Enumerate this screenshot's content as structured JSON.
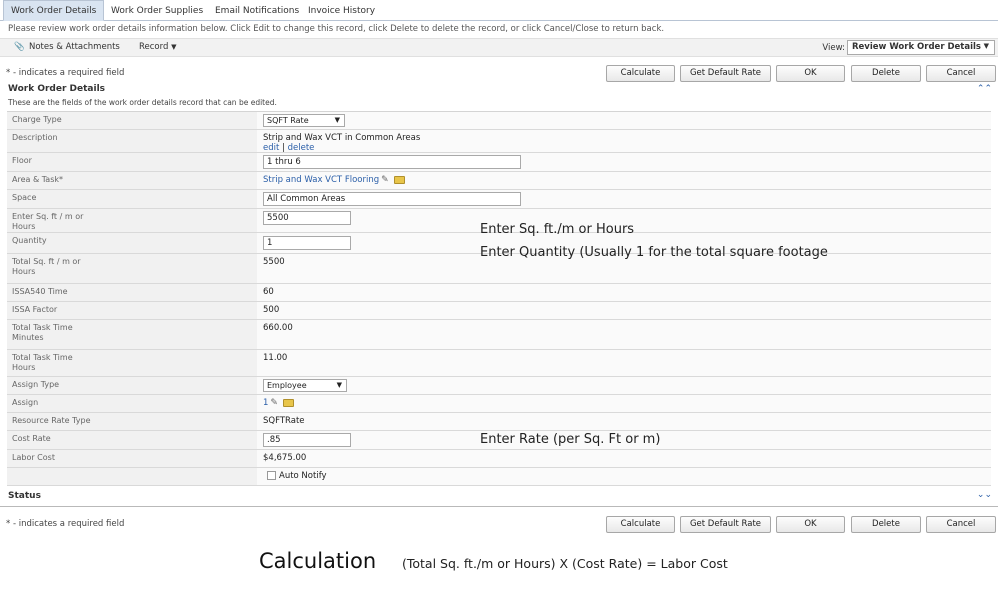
{
  "tabs": [
    {
      "label": "Work Order Details"
    },
    {
      "label": "Work Order Supplies"
    },
    {
      "label": "Email Notifications"
    },
    {
      "label": "Invoice History"
    }
  ],
  "instructions": "Please review work order details information below. Click Edit to change this record, click Delete to delete the record, or click Cancel/Close to return back.",
  "toolbar": {
    "notes_label": "Notes & Attachments",
    "record_label": "Record",
    "view_label": "View:",
    "view_value": "Review Work Order Details"
  },
  "required_note": "* - indicates a required field",
  "buttons": {
    "calculate": "Calculate",
    "get_default_rate": "Get Default Rate",
    "ok": "OK",
    "delete": "Delete",
    "cancel": "Cancel"
  },
  "section": {
    "title": "Work Order Details",
    "subtitle": "These are the fields of the work order details record that can be edited.",
    "status_title": "Status"
  },
  "fields": {
    "charge_type": {
      "label": "Charge Type",
      "value": "SQFT Rate"
    },
    "description": {
      "label": "Description",
      "value": "Strip and Wax VCT in Common Areas",
      "edit": "edit",
      "sep": "|",
      "delete": "delete"
    },
    "floor": {
      "label": "Floor",
      "value": "1 thru 6"
    },
    "area_task": {
      "label": "Area & Task*",
      "value": "Strip and Wax VCT Flooring"
    },
    "space": {
      "label": "Space",
      "value": "All Common Areas"
    },
    "enter_sqft": {
      "label_1": "Enter Sq. ft / m or",
      "label_2": "Hours",
      "value": "5500"
    },
    "quantity": {
      "label": "Quantity",
      "value": "1"
    },
    "total_sqft": {
      "label_1": "Total Sq. ft / m or",
      "label_2": "Hours",
      "value": "5500"
    },
    "issa_time": {
      "label": "ISSA540 Time",
      "value": "60"
    },
    "issa_factor": {
      "label": "ISSA Factor",
      "value": "500"
    },
    "total_minutes": {
      "label_1": "Total Task Time",
      "label_2": "Minutes",
      "value": "660.00"
    },
    "total_hours": {
      "label_1": "Total Task Time",
      "label_2": "Hours",
      "value": "11.00"
    },
    "assign_type": {
      "label": "Assign Type",
      "value": "Employee"
    },
    "assign": {
      "label": "Assign",
      "value": "1"
    },
    "resource_rate_type": {
      "label": "Resource Rate Type",
      "value": "SQFTRate"
    },
    "cost_rate": {
      "label": "Cost Rate",
      "value": ".85"
    },
    "labor_cost": {
      "label": "Labor Cost",
      "value": "$4,675.00"
    },
    "auto_notify": {
      "label": "Auto Notify"
    }
  },
  "annotations": {
    "sqft": "Enter Sq. ft./m or Hours",
    "quantity": "Enter Quantity (Usually 1 for the total square footage",
    "rate": "Enter Rate (per Sq. Ft or m)",
    "calc_title": "Calculation",
    "calc_formula": "(Total Sq. ft./m or Hours) X (Cost Rate) = Labor Cost"
  },
  "icons": {
    "paperclip": "paperclip-icon",
    "collapse": "collapse-up-icon",
    "expand": "expand-down-icon",
    "pencil": "pencil-icon",
    "folder": "folder-icon"
  }
}
